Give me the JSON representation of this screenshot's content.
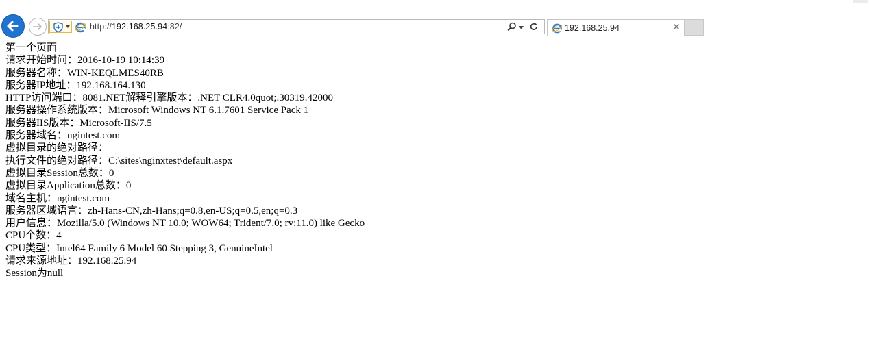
{
  "browser": {
    "address_bar": {
      "scheme": "http://",
      "host": "192.168.25.94",
      "port_path": ":82/"
    },
    "tab": {
      "title": "192.168.25.94",
      "close_label": "×"
    },
    "icons": {
      "back": "back-arrow-icon",
      "forward": "forward-arrow-icon",
      "security": "shield-icon",
      "site": "ie-logo-icon",
      "search": "search-icon",
      "dropdown": "chevron-down-icon",
      "refresh": "refresh-icon",
      "close": "close-icon"
    },
    "colors": {
      "back_button": "#1f74cf",
      "ie_logo": "#2a7fd4",
      "shield_border": "#e0b84c"
    }
  },
  "page": {
    "lines": [
      "第一个页面",
      "请求开始时间：2016-10-19 10:14:39",
      "服务器名称：WIN-KEQLMES40RB",
      "服务器IP地址：192.168.164.130",
      "HTTP访问端口：8081.NET解释引擎版本：.NET CLR4.0quot;.30319.42000",
      "服务器操作系统版本：Microsoft Windows NT 6.1.7601 Service Pack 1",
      "服务器IIS版本：Microsoft-IIS/7.5",
      "服务器域名：ngintest.com",
      "虚拟目录的绝对路径：",
      "执行文件的绝对路径：C:\\sites\\nginxtest\\default.aspx",
      "虚拟目录Session总数：0",
      "虚拟目录Application总数：0",
      "域名主机：ngintest.com",
      "服务器区域语言：zh-Hans-CN,zh-Hans;q=0.8,en-US;q=0.5,en;q=0.3",
      "用户信息：Mozilla/5.0 (Windows NT 10.0; WOW64; Trident/7.0; rv:11.0) like Gecko",
      "CPU个数：4",
      "CPU类型：Intel64 Family 6 Model 60 Stepping 3, GenuineIntel",
      "请求来源地址：192.168.25.94",
      "Session为null"
    ]
  }
}
